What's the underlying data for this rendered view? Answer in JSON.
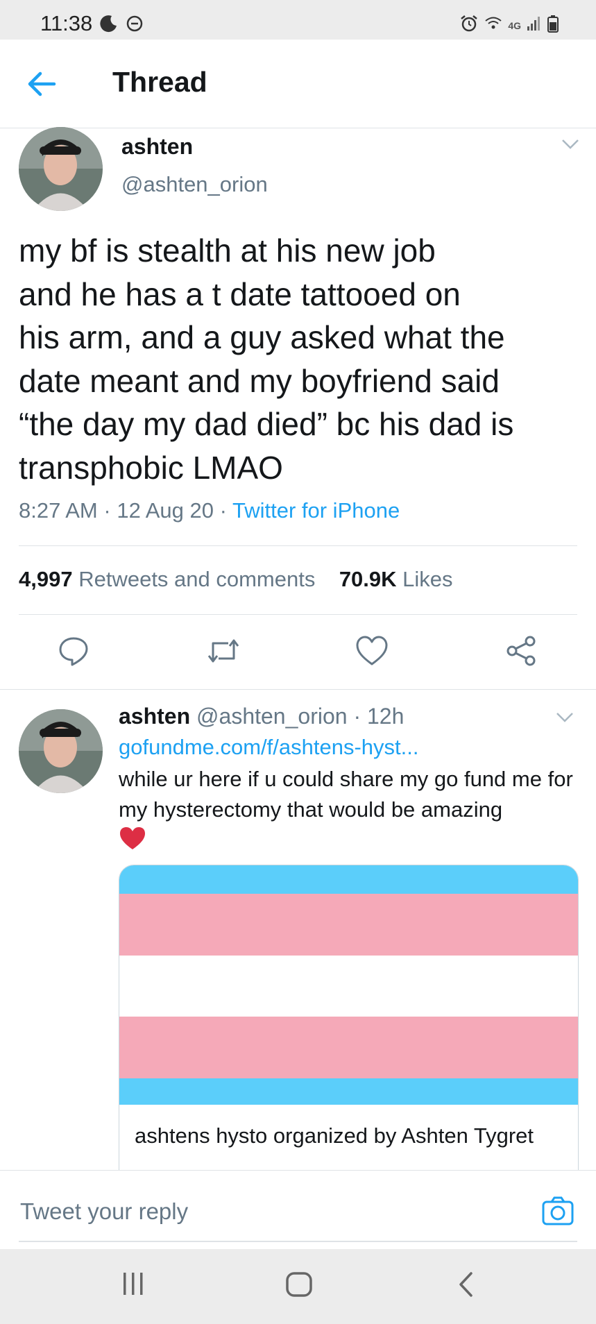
{
  "status_bar": {
    "time": "11:38",
    "network_label": "4G",
    "icons": [
      "moon-icon",
      "do-not-disturb-icon",
      "alarm-icon",
      "wifi-icon",
      "signal-icon",
      "battery-icon"
    ]
  },
  "header": {
    "back_icon": "arrow-left-icon",
    "title": "Thread"
  },
  "main_tweet": {
    "name": "ashten",
    "handle": "@ashten_orion",
    "text": "my bf is stealth at his new job\nand he has a t date tattooed on\nhis arm, and a guy asked what the\ndate meant and my boyfriend said\n“the day my dad died” bc his dad is\ntransphobic LMAO",
    "time": "8:27 AM",
    "separator": "·",
    "date": "12 Aug 20",
    "source": "Twitter for iPhone",
    "retweets_count": "4,997",
    "retweets_label": "Retweets and comments",
    "likes_count": "70.9K",
    "likes_label": "Likes",
    "actions": [
      "reply-icon",
      "retweet-icon",
      "like-icon",
      "share-icon"
    ]
  },
  "reply_tweet": {
    "name": "ashten",
    "handle": "@ashten_orion",
    "separator": "·",
    "age": "12h",
    "link": "gofundme.com/f/ashtens-hyst...",
    "text": "while ur here if u could share my go fund me for my hysterectomy that would be amazing",
    "emoji": "red-heart-icon",
    "card": {
      "flag_colors": [
        "#5bcefa",
        "#f5a9b8",
        "#ffffff",
        "#f5a9b8",
        "#5bcefa"
      ],
      "title": "ashtens hysto organized by Ashten Tygret"
    }
  },
  "reply_bar": {
    "placeholder": "Tweet your reply",
    "camera_icon": "camera-icon"
  },
  "nav_bar": {
    "buttons": [
      "recent-apps-icon",
      "home-icon",
      "back-icon"
    ]
  },
  "colors": {
    "accent": "#1da1f2",
    "secondary_text": "#657786",
    "divider": "#dfe3e6"
  }
}
